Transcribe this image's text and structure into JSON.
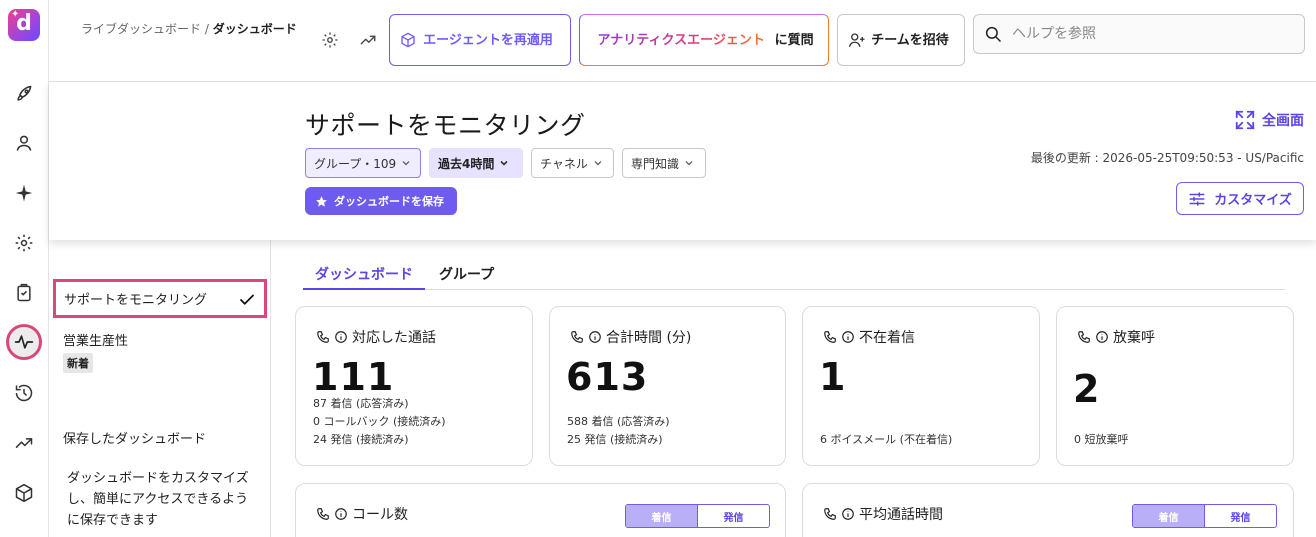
{
  "brand": {
    "logo_letter": "d",
    "accent": "#6e5cf0",
    "highlight": "#d9477f"
  },
  "rail": {
    "icons": [
      "rocket-icon",
      "person-icon",
      "sparkle-icon",
      "gear-icon",
      "clipboard-icon",
      "activity-icon",
      "history-icon",
      "trend-icon",
      "cube-icon"
    ],
    "active": "activity-icon"
  },
  "header": {
    "breadcrumb_parent": "ライブダッシュボード",
    "breadcrumb_sep": "/",
    "breadcrumb_current": "ダッシュボード",
    "reapply_agent": "エージェントを再適用",
    "analytics_agent": "アナリティクスエージェント",
    "ask": "に質問",
    "invite_team": "チームを招待",
    "search_placeholder": "ヘルプを参照"
  },
  "title_band": {
    "title": "サポートをモニタリング",
    "filters": {
      "group": "グループ・109",
      "time": "過去4時間",
      "channel": "チャネル",
      "expertise": "専門知識"
    },
    "save_dashboard": "ダッシュボードを保存",
    "fullscreen": "全画面",
    "last_updated": "最後の更新 : 2026-05-25T09:50:53 - US/Pacific",
    "customize": "カスタマイズ"
  },
  "sidebar": {
    "items": [
      {
        "label": "サポートをモニタリング",
        "selected": true
      },
      {
        "label": "営業生産性",
        "badge": "新着"
      }
    ],
    "saved_heading": "保存したダッシュボード",
    "saved_description": "ダッシュボードをカスタマイズし、簡単にアクセスできるように保存できます"
  },
  "tabs": [
    "ダッシュボード",
    "グループ"
  ],
  "cards": [
    {
      "title": "対応した通話",
      "value": "111",
      "details": [
        "87 着信 (応答済み)",
        "0 コールバック (接続済み)",
        "24 発信 (接続済み)"
      ]
    },
    {
      "title": "合計時間 (分)",
      "value": "613",
      "details": [
        "588 着信 (応答済み)",
        "25 発信 (接続済み)"
      ]
    },
    {
      "title": "不在着信",
      "value": "1",
      "details": [
        "6 ボイスメール (不在着信)"
      ]
    },
    {
      "title": "放棄呼",
      "value": "2",
      "details": [
        "0 短放棄呼"
      ]
    }
  ],
  "lower_cards": [
    {
      "title": "コール数",
      "toggle_on": "着信",
      "toggle_off": "発信"
    },
    {
      "title": "平均通話時間",
      "toggle_on": "着信",
      "toggle_off": "発信"
    }
  ]
}
